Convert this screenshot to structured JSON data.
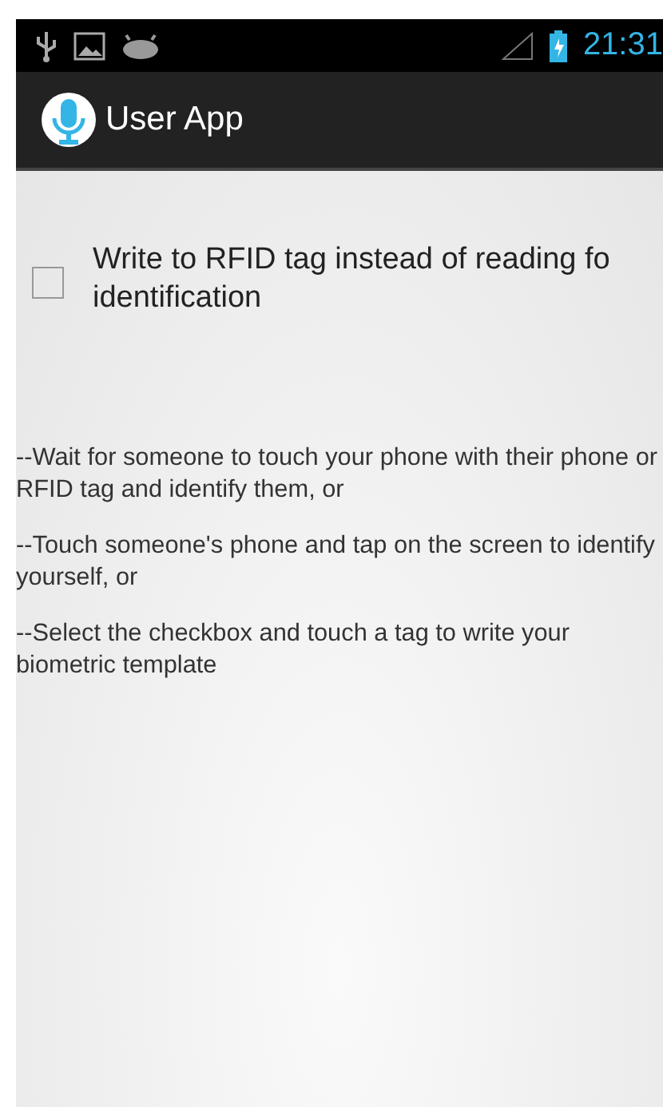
{
  "status_bar": {
    "time": "21:31"
  },
  "action_bar": {
    "title": "User App"
  },
  "checkbox": {
    "checked": false,
    "label_lines": [
      "Write to RFID tag instead of reading fo",
      "identification"
    ]
  },
  "instructions": [
    "--Wait for someone to touch your phone with their phone or RFID tag and identify them, or",
    "--Touch someone's phone and tap on the screen to identify yourself, or",
    "--Select the checkbox and touch a tag to write your biometric template"
  ]
}
